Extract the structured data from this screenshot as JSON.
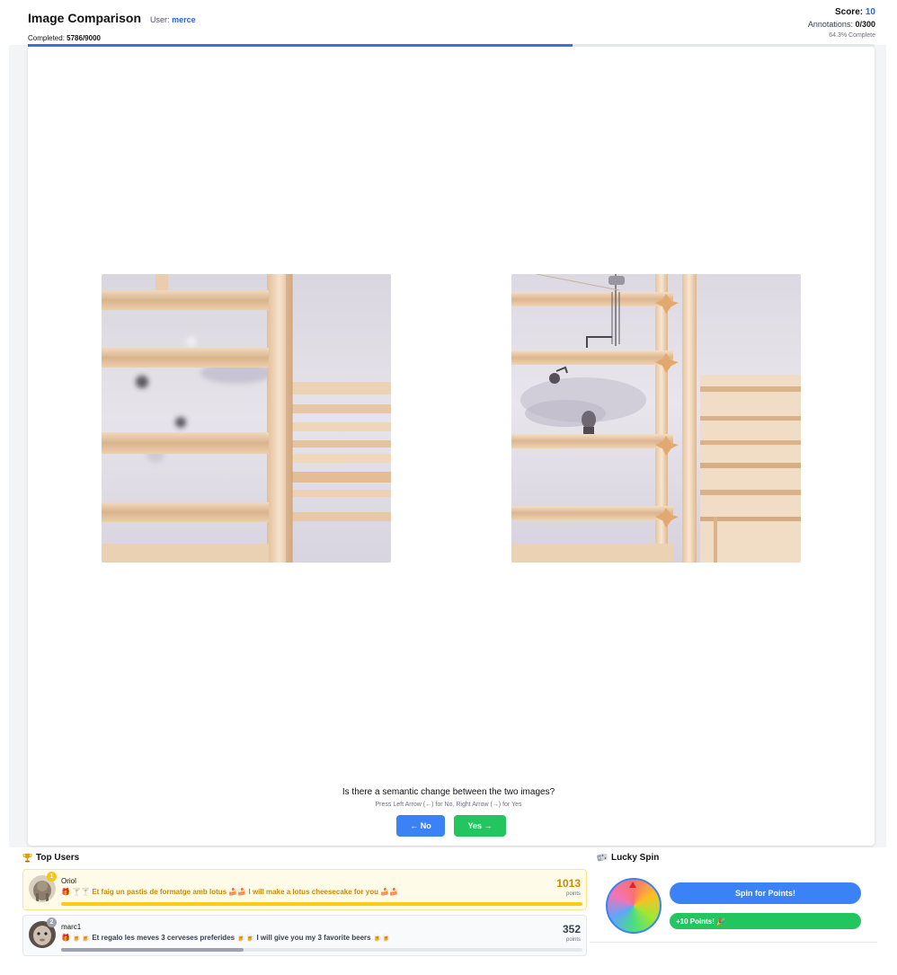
{
  "header": {
    "title": "Image Comparison",
    "user_label": "User:",
    "user_name": "merce",
    "completed_label": "Completed:",
    "completed_value": "5786/9000",
    "score_label": "Score:",
    "score_value": "10",
    "annotations_label": "Annotations:",
    "annotations_value": "0/300",
    "percent_text": "64.3% Complete",
    "progress_fraction": 0.643
  },
  "task": {
    "question": "Is there a semantic change between the two images?",
    "hint": "Press Left Arrow (←) for No, Right Arrow (→) for Yes",
    "no_label": "← No",
    "yes_label": "Yes →"
  },
  "leaderboard": {
    "title": "Top Users",
    "title_icon": "trophy-icon",
    "users": [
      {
        "rank": "1",
        "name": "Oriol",
        "message": "🎁 🍸🍸 Et faig un pastis de formatge amb lotus 🍰🍰 I will make a lotus cheesecake for you 🍰🍰",
        "points": "1013",
        "points_label": "points",
        "bar_fraction": 1.0
      },
      {
        "rank": "2",
        "name": "marc1",
        "message": "🎁 🍺🍺 Et regalo les meves 3 cerveses preferides 🍺🍺 I will give you my 3 favorite beers 🍺🍺",
        "points": "352",
        "points_label": "points",
        "bar_fraction": 0.35
      }
    ]
  },
  "lucky_spin": {
    "title": "Lucky Spin",
    "title_icon": "dice-icon",
    "spin_label": "Spin for Points!",
    "result_text": "+10 Points! 🎉"
  },
  "colors": {
    "accent": "#3b82f6",
    "success": "#22c55e",
    "gold": "#ca8a04"
  }
}
